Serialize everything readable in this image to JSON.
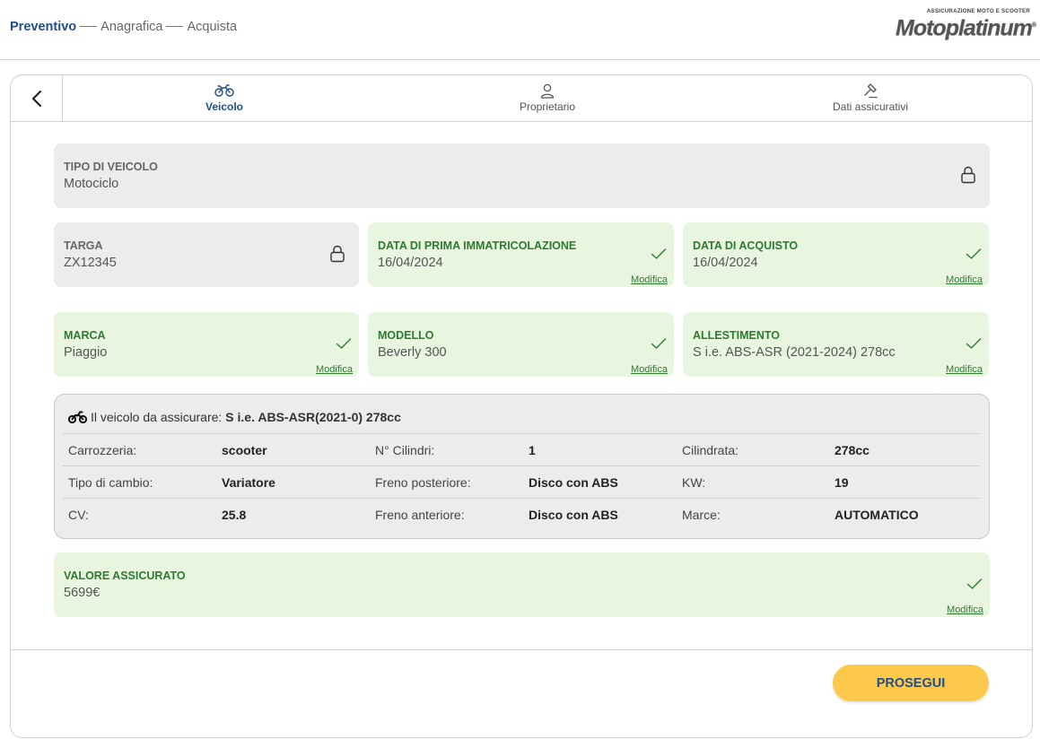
{
  "breadcrumb": {
    "step1": "Preventivo",
    "step2": "Anagrafica",
    "step3": "Acquista"
  },
  "logo": {
    "tagline": "ASSICURAZIONE MOTO E SCOOTER",
    "brand": "Motoplatinum"
  },
  "tabs": {
    "vehicle": "Veicolo",
    "owner": "Proprietario",
    "insurance": "Dati assicurativi"
  },
  "fields": {
    "tipo": {
      "label": "TIPO DI VEICOLO",
      "value": "Motociclo"
    },
    "targa": {
      "label": "TARGA",
      "value": "ZX12345"
    },
    "immatricolazione": {
      "label": "DATA DI PRIMA IMMATRICOLAZIONE",
      "value": "16/04/2024",
      "edit": "Modifica"
    },
    "acquisto": {
      "label": "DATA DI ACQUISTO",
      "value": "16/04/2024",
      "edit": "Modifica"
    },
    "marca": {
      "label": "MARCA",
      "value": "Piaggio",
      "edit": "Modifica"
    },
    "modello": {
      "label": "MODELLO",
      "value": "Beverly 300",
      "edit": "Modifica"
    },
    "allestimento": {
      "label": "ALLESTIMENTO",
      "value": "S i.e. ABS-ASR (2021-2024) 278cc",
      "edit": "Modifica"
    },
    "valore": {
      "label": "VALORE ASSICURATO",
      "value": "5699€",
      "edit": "Modifica"
    }
  },
  "vehicle": {
    "intro": "Il veicolo da assicurare:",
    "name": "S i.e. ABS-ASR(2021-0) 278cc",
    "rows": [
      [
        {
          "k": "Carrozzeria:",
          "v": "scooter"
        },
        {
          "k": "N° Cilindri:",
          "v": "1"
        },
        {
          "k": "Cilindrata:",
          "v": "278cc"
        }
      ],
      [
        {
          "k": "Tipo di cambio:",
          "v": "Variatore"
        },
        {
          "k": "Freno posteriore:",
          "v": "Disco con ABS"
        },
        {
          "k": "KW:",
          "v": "19"
        }
      ],
      [
        {
          "k": "CV:",
          "v": "25.8"
        },
        {
          "k": "Freno anteriore:",
          "v": "Disco con ABS"
        },
        {
          "k": "Marce:",
          "v": "AUTOMATICO"
        }
      ]
    ]
  },
  "actions": {
    "continue": "PROSEGUI"
  },
  "colors": {
    "primary": "#1f4e8c",
    "success": "#2e7a32",
    "success_bg": "#e8f6df",
    "locked_bg": "#ececec",
    "button": "#fcc94c"
  }
}
